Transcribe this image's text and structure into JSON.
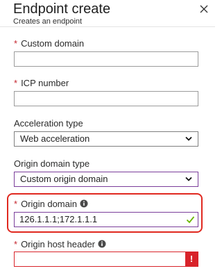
{
  "header": {
    "title": "Endpoint create",
    "subtitle": "Creates an endpoint",
    "close_icon": "close-icon"
  },
  "form": {
    "required_marker": "*",
    "custom_domain": {
      "label": "Custom domain",
      "value": ""
    },
    "icp_number": {
      "label": "ICP number",
      "value": ""
    },
    "acceleration_type": {
      "label": "Acceleration type",
      "selected": "Web acceleration"
    },
    "origin_domain_type": {
      "label": "Origin domain type",
      "selected": "Custom origin domain"
    },
    "origin_domain": {
      "label": "Origin domain",
      "value": "126.1.1.1;172.1.1.1",
      "status": "valid"
    },
    "origin_host_header": {
      "label": "Origin host header",
      "value": "",
      "status": "error",
      "error_glyph": "!"
    }
  },
  "colors": {
    "required": "#c4262e",
    "focus_border": "#7a3d9a",
    "error": "#d8232a",
    "valid": "#6bb700",
    "highlight": "#e0281f"
  }
}
